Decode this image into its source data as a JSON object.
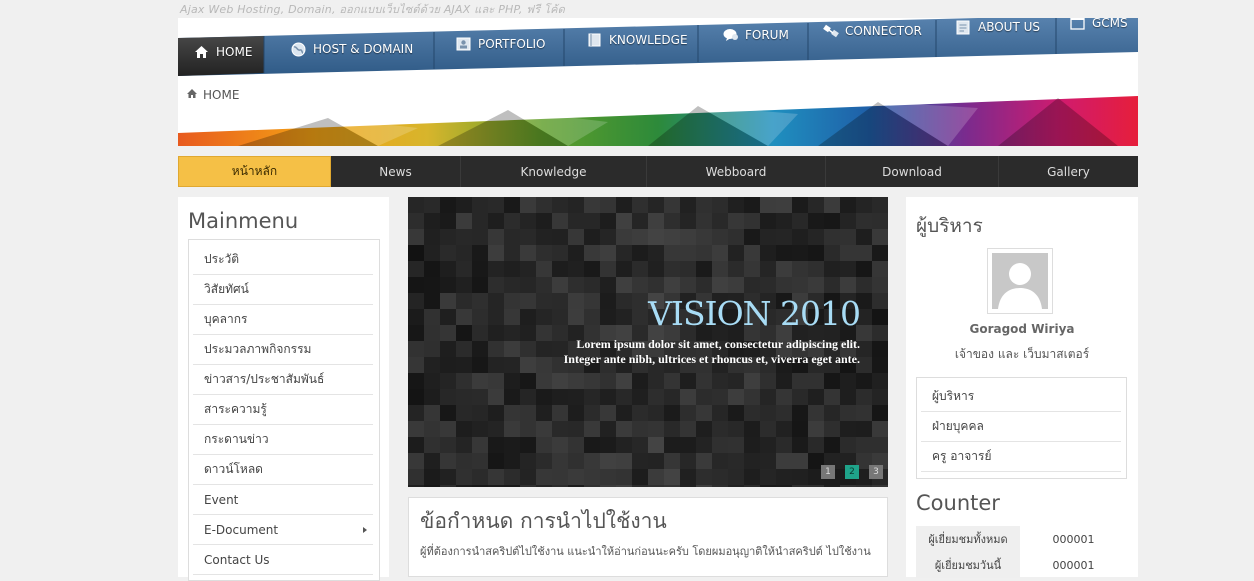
{
  "site": {
    "tagline": "Ajax Web Hosting, Domain, ออกแบบเว็บไซต์ด้วย AJAX และ PHP, ฟรี โค้ด"
  },
  "topnav": [
    {
      "label": "HOME",
      "icon": "home-icon",
      "active": true
    },
    {
      "label": "HOST & DOMAIN",
      "icon": "globe-icon"
    },
    {
      "label": "PORTFOLIO",
      "icon": "portfolio-icon"
    },
    {
      "label": "KNOWLEDGE",
      "icon": "book-icon"
    },
    {
      "label": "FORUM",
      "icon": "chat-icon"
    },
    {
      "label": "CONNECTOR",
      "icon": "plug-icon"
    },
    {
      "label": "ABOUT US",
      "icon": "document-icon"
    },
    {
      "label": "GCMS",
      "icon": "window-icon"
    }
  ],
  "breadcrumb": {
    "label": "HOME"
  },
  "menubar": [
    {
      "label": "หน้าหลัก",
      "active": true
    },
    {
      "label": "News"
    },
    {
      "label": "Knowledge"
    },
    {
      "label": "Webboard"
    },
    {
      "label": "Download"
    },
    {
      "label": "Gallery"
    }
  ],
  "mainmenu": {
    "title": "Mainmenu",
    "items": [
      {
        "label": "ประวัติ"
      },
      {
        "label": "วิสัยทัศน์"
      },
      {
        "label": "บุคลากร"
      },
      {
        "label": "ประมวลภาพกิจกรรม"
      },
      {
        "label": "ข่าวสาร/ประชาสัมพันธ์"
      },
      {
        "label": "สาระความรู้"
      },
      {
        "label": "กระดานข่าว"
      },
      {
        "label": "ดาวน์โหลด"
      },
      {
        "label": "Event"
      },
      {
        "label": "E-Document",
        "submenu": true
      },
      {
        "label": "Contact Us"
      }
    ]
  },
  "slider": {
    "title": "VISION 2010",
    "line1": "Lorem ipsum dolor sit amet, consectetur adipiscing elit.",
    "line2": "Integer ante nibh, ultrices et rhoncus et, viverra eget ante.",
    "pages": [
      "1",
      "2",
      "3"
    ],
    "current": "2"
  },
  "content": {
    "title": "ข้อกำหนด การนำไปใช้งาน",
    "text": "ผู้ที่ต้องการนำสคริปต์ไปใช้งาน แนะนำให้อ่านก่อนนะครับ โดยผมอนุญาติให้นำสคริปต์ ไปใช้งาน"
  },
  "admin": {
    "title": "ผู้บริหาร",
    "name": "Goragod Wiriya",
    "role": "เจ้าของ และ เว็บมาสเตอร์",
    "links": [
      {
        "label": "ผู้บริหาร"
      },
      {
        "label": "ฝ่ายบุคคล"
      },
      {
        "label": "ครู อาจารย์"
      }
    ]
  },
  "counter": {
    "title": "Counter",
    "rows": [
      {
        "label": "ผู้เยี่ยมชมทั้งหมด",
        "value": "000001"
      },
      {
        "label": "ผู้เยี่ยมชมวันนี้",
        "value": "000001"
      }
    ]
  },
  "colors": {
    "nav_blue": "#3d6592",
    "nav_active": "#2e2e2e",
    "menubar_bg": "#2b2b2b",
    "menubar_active": "#f5c046",
    "slider_title": "#a8dcf5",
    "slider_dot_active": "#1fa38a"
  }
}
